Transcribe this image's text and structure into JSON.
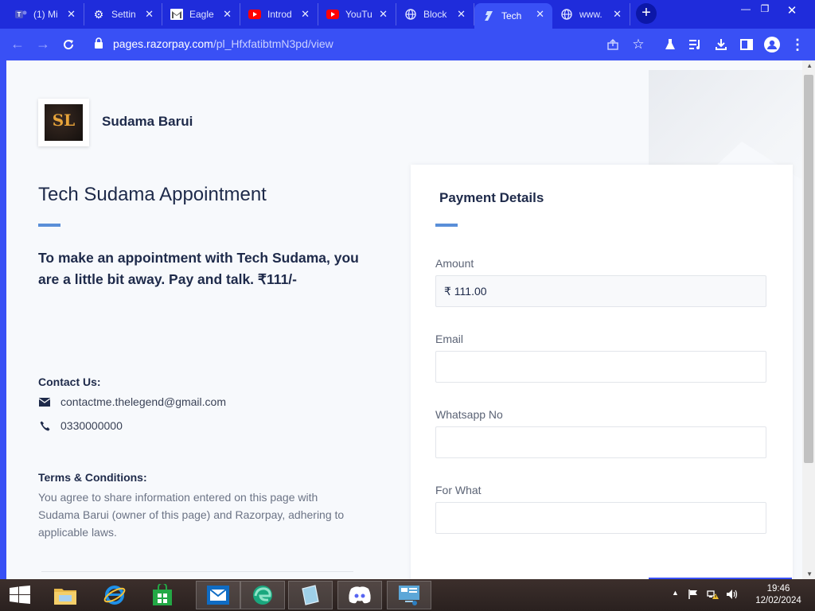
{
  "browser": {
    "tabs": [
      {
        "icon": "teams-icon",
        "title": "(1) Mi",
        "active": false
      },
      {
        "icon": "settings-gear-icon",
        "title": "Settin",
        "active": false
      },
      {
        "icon": "gmail-icon",
        "title": "Eagle",
        "active": false
      },
      {
        "icon": "youtube-icon",
        "title": "Introd",
        "active": false
      },
      {
        "icon": "youtube-icon",
        "title": "YouTu",
        "active": false
      },
      {
        "icon": "globe-icon",
        "title": "Block",
        "active": false
      },
      {
        "icon": "razorpay-icon",
        "title": "Tech",
        "active": true
      },
      {
        "icon": "globe-icon",
        "title": "www.",
        "active": false
      }
    ],
    "url_host": "pages.razorpay.com",
    "url_path": "/pl_HfxfatibtmN3pd/view"
  },
  "page": {
    "merchant_name": "Sudama Barui",
    "logo_text": "SL",
    "title": "Tech Sudama Appointment",
    "description": "To make an appointment with Tech Sudama, you are a little bit away. Pay and talk. ₹111/-",
    "contact_heading": "Contact Us:",
    "contact_email": "contactme.thelegend@gmail.com",
    "contact_phone": "0330000000",
    "terms_heading": "Terms & Conditions:",
    "terms_text": "You agree to share information entered on this page with Sudama Barui (owner of this page) and Razorpay, adhering to applicable laws."
  },
  "payment": {
    "title": "Payment Details",
    "fields": [
      {
        "label": "Amount",
        "value": "₹ 111.00"
      },
      {
        "label": "Email",
        "value": ""
      },
      {
        "label": "Whatsapp No",
        "value": ""
      },
      {
        "label": "For What",
        "value": ""
      }
    ]
  },
  "taskbar": {
    "time": "19:46",
    "date": "12/02/2024"
  },
  "colors": {
    "browser_accent": "#3950f5",
    "tabstrip": "#1f2cdb",
    "heading_text": "#1e2a4a",
    "accent_line": "#5a8fd8"
  }
}
